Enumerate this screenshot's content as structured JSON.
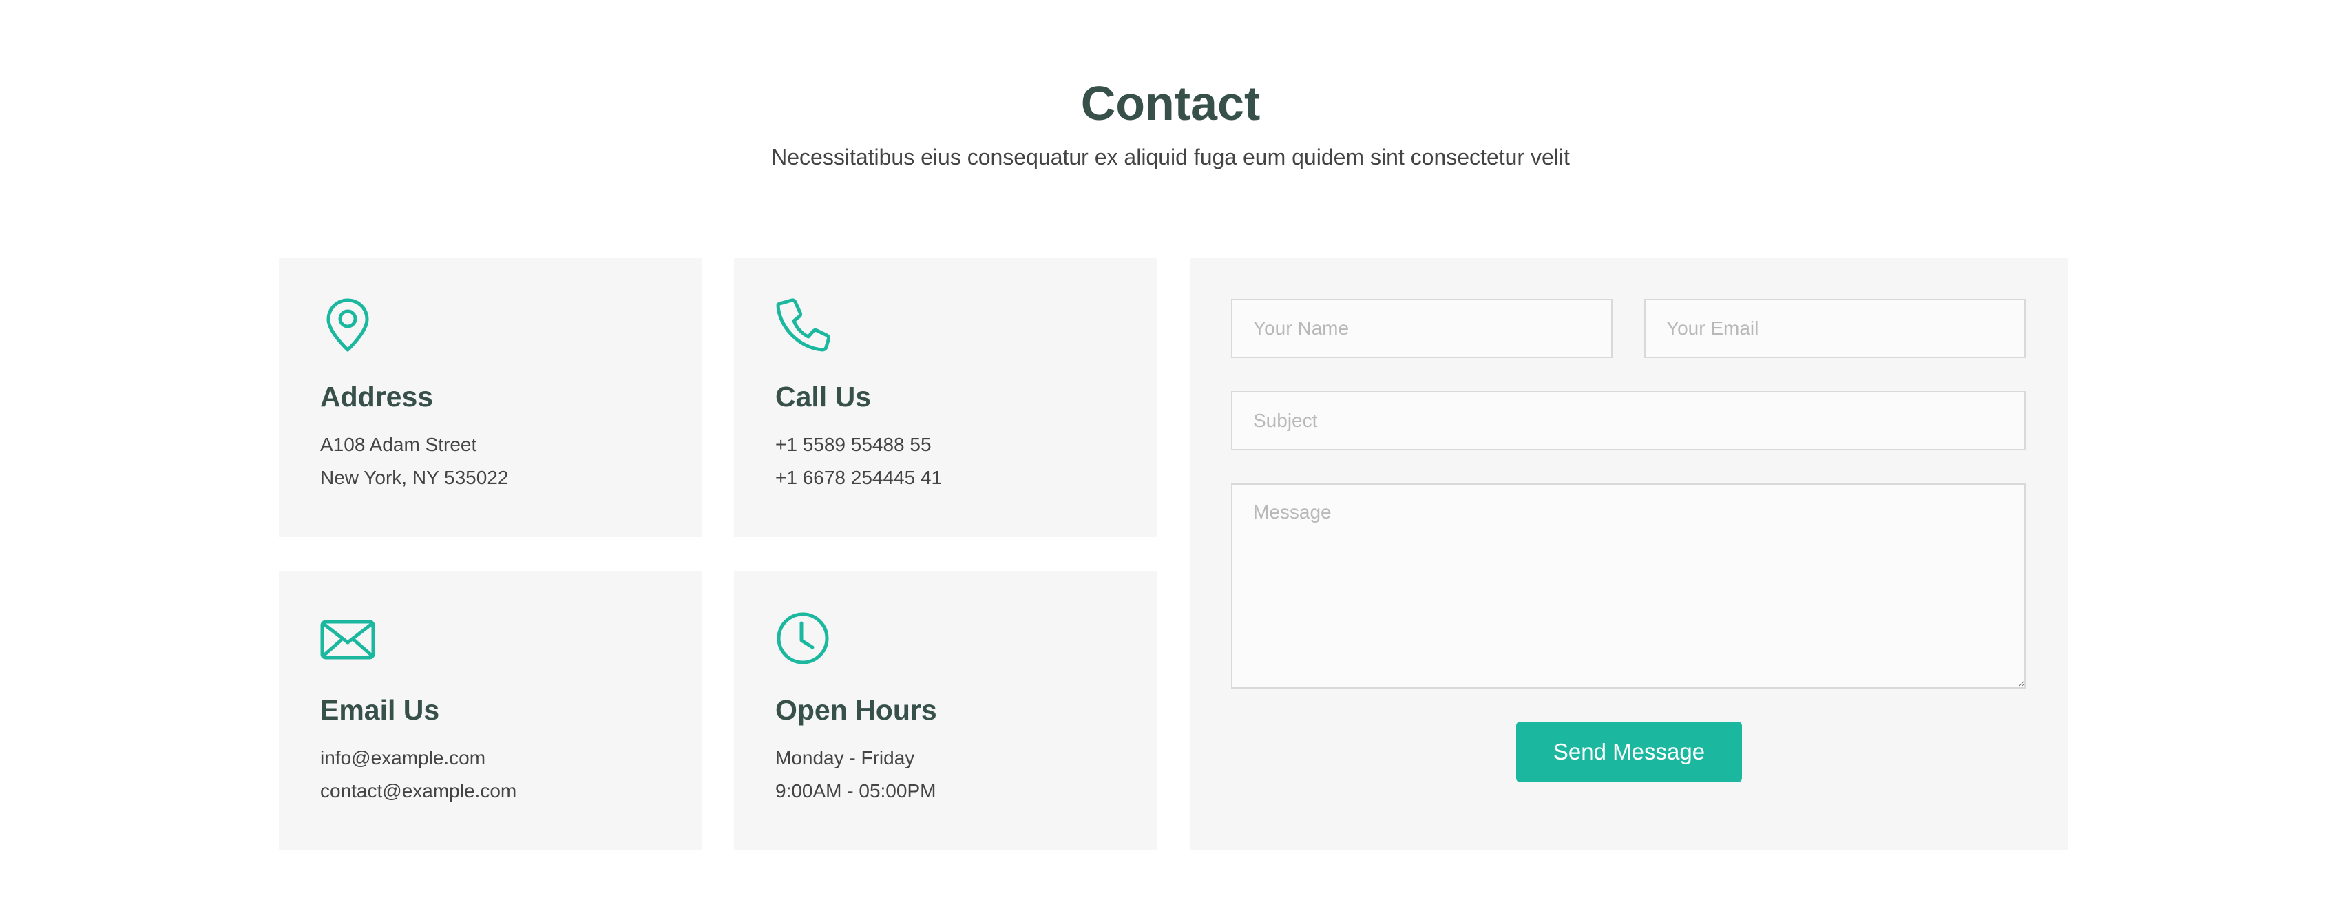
{
  "section": {
    "title": "Contact",
    "subtitle": "Necessitatibus eius consequatur ex aliquid fuga eum quidem sint consectetur velit"
  },
  "accent_color": "#1bb89f",
  "heading_color": "#37514a",
  "cards": {
    "address": {
      "icon": "map-pin-icon",
      "title": "Address",
      "line1": "A108 Adam Street",
      "line2": "New York, NY 535022"
    },
    "call": {
      "icon": "phone-icon",
      "title": "Call Us",
      "line1": "+1 5589 55488 55",
      "line2": "+1 6678 254445 41"
    },
    "email": {
      "icon": "envelope-icon",
      "title": "Email Us",
      "line1": "info@example.com",
      "line2": "contact@example.com"
    },
    "hours": {
      "icon": "clock-icon",
      "title": "Open Hours",
      "line1": "Monday - Friday",
      "line2": "9:00AM - 05:00PM"
    }
  },
  "form": {
    "name_placeholder": "Your Name",
    "email_placeholder": "Your Email",
    "subject_placeholder": "Subject",
    "message_placeholder": "Message",
    "submit_label": "Send Message"
  }
}
